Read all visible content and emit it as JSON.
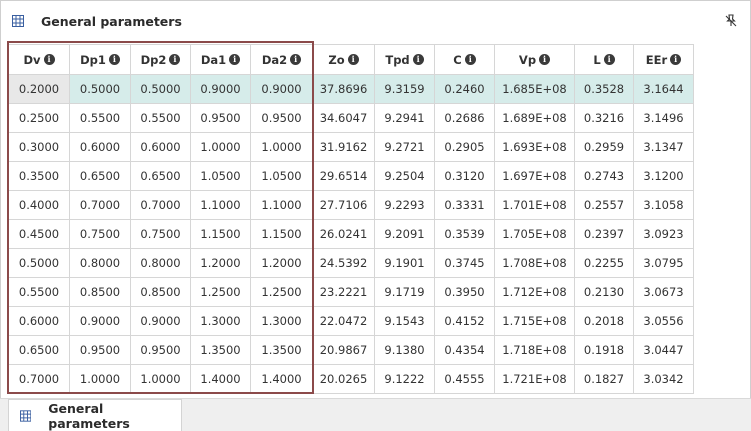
{
  "panel": {
    "title": "General parameters",
    "title_icon": "table-grid-icon",
    "pin_icon": "pin-off-icon"
  },
  "table": {
    "columns": [
      "Dv",
      "Dp1",
      "Dp2",
      "Da1",
      "Da2",
      "Zo",
      "Tpd",
      "C",
      "Vp",
      "L",
      "EEr"
    ],
    "info_glyph": "i",
    "selected_row": 0,
    "rows": [
      [
        "0.2000",
        "0.5000",
        "0.5000",
        "0.9000",
        "0.9000",
        "37.8696",
        "9.3159",
        "0.2460",
        "1.685E+08",
        "0.3528",
        "3.1644"
      ],
      [
        "0.2500",
        "0.5500",
        "0.5500",
        "0.9500",
        "0.9500",
        "34.6047",
        "9.2941",
        "0.2686",
        "1.689E+08",
        "0.3216",
        "3.1496"
      ],
      [
        "0.3000",
        "0.6000",
        "0.6000",
        "1.0000",
        "1.0000",
        "31.9162",
        "9.2721",
        "0.2905",
        "1.693E+08",
        "0.2959",
        "3.1347"
      ],
      [
        "0.3500",
        "0.6500",
        "0.6500",
        "1.0500",
        "1.0500",
        "29.6514",
        "9.2504",
        "0.3120",
        "1.697E+08",
        "0.2743",
        "3.1200"
      ],
      [
        "0.4000",
        "0.7000",
        "0.7000",
        "1.1000",
        "1.1000",
        "27.7106",
        "9.2293",
        "0.3331",
        "1.701E+08",
        "0.2557",
        "3.1058"
      ],
      [
        "0.4500",
        "0.7500",
        "0.7500",
        "1.1500",
        "1.1500",
        "26.0241",
        "9.2091",
        "0.3539",
        "1.705E+08",
        "0.2397",
        "3.0923"
      ],
      [
        "0.5000",
        "0.8000",
        "0.8000",
        "1.2000",
        "1.2000",
        "24.5392",
        "9.1901",
        "0.3745",
        "1.708E+08",
        "0.2255",
        "3.0795"
      ],
      [
        "0.5500",
        "0.8500",
        "0.8500",
        "1.2500",
        "1.2500",
        "23.2221",
        "9.1719",
        "0.3950",
        "1.712E+08",
        "0.2130",
        "3.0673"
      ],
      [
        "0.6000",
        "0.9000",
        "0.9000",
        "1.3000",
        "1.3000",
        "22.0472",
        "9.1543",
        "0.4152",
        "1.715E+08",
        "0.2018",
        "3.0556"
      ],
      [
        "0.6500",
        "0.9500",
        "0.9500",
        "1.3500",
        "1.3500",
        "20.9867",
        "9.1380",
        "0.4354",
        "1.718E+08",
        "0.1918",
        "3.0447"
      ],
      [
        "0.7000",
        "1.0000",
        "1.0000",
        "1.4000",
        "1.4000",
        "20.0265",
        "9.1222",
        "0.4555",
        "1.721E+08",
        "0.1827",
        "3.0342"
      ]
    ]
  },
  "tabs": [
    {
      "label": "General parameters",
      "icon": "table-grid-icon"
    }
  ],
  "colors": {
    "selected_row": "#d6ecea",
    "highlight_border": "#8b4a4a",
    "grid_border": "#d6d6d6"
  }
}
